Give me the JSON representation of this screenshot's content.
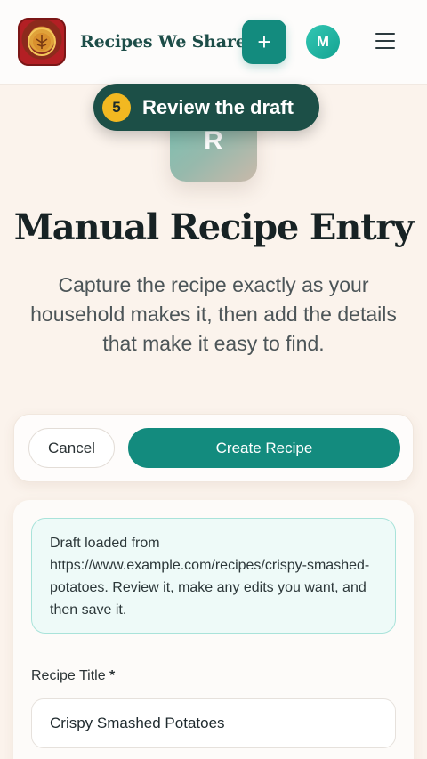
{
  "header": {
    "brand": "Recipes We Share",
    "add_label": "+",
    "avatar_initial": "M"
  },
  "tour": {
    "step": "5",
    "text": "Review the draft"
  },
  "page": {
    "icon_letter": "R",
    "title": "Manual Recipe Entry",
    "subtitle": "Capture the recipe exactly as your household makes it, then add the details that make it easy to find."
  },
  "actions": {
    "cancel_label": "Cancel",
    "create_label": "Create Recipe"
  },
  "form": {
    "notice": "Draft loaded from https://www.example.com/recipes/crispy-smashed-potatoes. Review it, make any edits you want, and then save it.",
    "title_label": "Recipe Title",
    "title_required": "*",
    "title_value": "Crispy Smashed Potatoes"
  },
  "colors": {
    "accent": "#138b7e",
    "tour_bg": "#1c4f47",
    "tour_badge": "#f2b821",
    "background": "#fbf3ec"
  }
}
